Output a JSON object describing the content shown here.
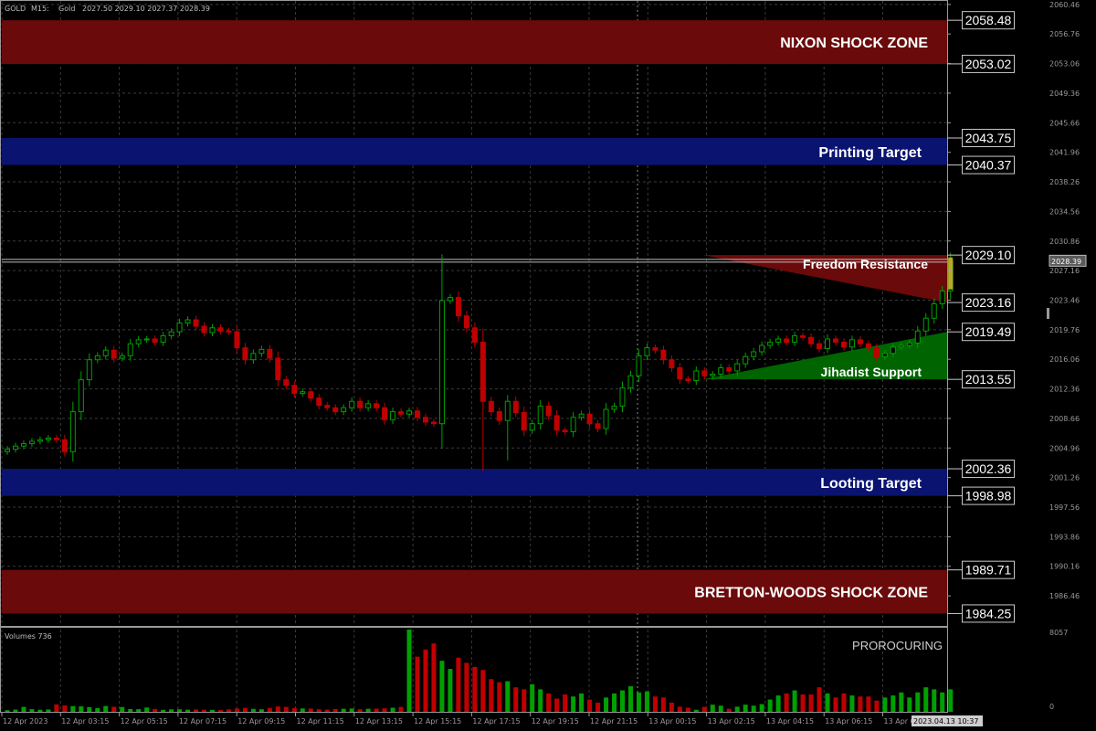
{
  "header": {
    "symbol": "GOLD",
    "timeframe": "M15:",
    "instrument": "Gold",
    "ohlc": "2027.50 2029.10 2027.37 2028.39"
  },
  "volume_panel": {
    "title": "Volumes 736",
    "axis_max_label": "8057",
    "axis_min_label": "0"
  },
  "watermark": "PROROCURING",
  "current_price_label": "2028.39",
  "cursor_time_label": "2023.04.13 10:37",
  "colors": {
    "background": "#000000",
    "grid": "#3a3a3a",
    "bull": "#00a000",
    "bear": "#c00000",
    "shock_zone": "#6b0a0a",
    "target_zone": "#0a1470",
    "resistance_triangle": "#6b0a0a",
    "support_triangle": "#006400",
    "axis_text": "#9a9a9a",
    "price_box_border": "#c8c8c8"
  },
  "chart_data": {
    "type": "candlestick",
    "price_ylim": [
      1982.7,
      2060.9
    ],
    "price_ticks": [
      "2060.46",
      "2056.76",
      "2053.06",
      "2049.36",
      "2045.66",
      "2041.96",
      "2038.26",
      "2034.56",
      "2030.86",
      "2027.16",
      "2023.46",
      "2019.76",
      "2016.06",
      "2012.36",
      "2008.66",
      "2004.96",
      "2001.26",
      "1997.56",
      "1993.86",
      "1990.16",
      "1986.46"
    ],
    "time_labels": [
      "12 Apr 2023",
      "12 Apr 03:15",
      "12 Apr 05:15",
      "12 Apr 07:15",
      "12 Apr 09:15",
      "12 Apr 11:15",
      "12 Apr 13:15",
      "12 Apr 15:15",
      "12 Apr 17:15",
      "12 Apr 19:15",
      "12 Apr 21:15",
      "13 Apr 00:15",
      "13 Apr 02:15",
      "13 Apr 04:15",
      "13 Apr 06:15",
      "13 Apr 08:15"
    ],
    "grid": true,
    "zones": [
      {
        "name": "NIXON SHOCK ZONE",
        "type": "shock",
        "top": 2058.48,
        "bottom": 2053.02
      },
      {
        "name": "Printing Target",
        "type": "target",
        "top": 2043.75,
        "bottom": 2040.37
      },
      {
        "name": "Looting Target",
        "type": "target",
        "top": 2002.36,
        "bottom": 1998.98
      },
      {
        "name": "BRETTON-WOODS SHOCK ZONE",
        "type": "shock",
        "top": 1989.71,
        "bottom": 1984.25
      }
    ],
    "triangles": [
      {
        "name": "Freedom Resistance",
        "type": "resistance",
        "start_index": 85,
        "start_price": 2029.1,
        "top": 2029.1,
        "bottom": 2023.16
      },
      {
        "name": "Jihadist Support",
        "type": "support",
        "start_index": 85,
        "start_price": 2013.55,
        "top": 2019.49,
        "bottom": 2013.55
      }
    ],
    "price_labels": [
      "2058.48",
      "2053.02",
      "2043.75",
      "2040.37",
      "2029.10",
      "2023.16",
      "2019.49",
      "2013.55",
      "2002.36",
      "1998.98",
      "1989.71",
      "1984.25"
    ],
    "closes": [
      2004.8,
      2005.2,
      2005.5,
      2005.8,
      2006.0,
      2006.2,
      2006.0,
      2004.5,
      2009.5,
      2013.5,
      2016.0,
      2016.5,
      2017.2,
      2016.2,
      2016.5,
      2018.0,
      2018.5,
      2018.6,
      2018.2,
      2019.0,
      2019.5,
      2020.6,
      2021.0,
      2020.2,
      2019.4,
      2020.0,
      2019.6,
      2019.5,
      2017.5,
      2016.0,
      2016.8,
      2017.3,
      2016.2,
      2013.5,
      2012.8,
      2011.8,
      2012.0,
      2011.2,
      2010.3,
      2010.0,
      2009.5,
      2010.0,
      2010.8,
      2010.0,
      2010.5,
      2010.0,
      2008.5,
      2009.5,
      2009.2,
      2009.6,
      2008.8,
      2008.2,
      2008.0,
      2023.4,
      2023.8,
      2021.5,
      2020.0,
      2018.2,
      2010.8,
      2009.5,
      2008.4,
      2010.8,
      2009.4,
      2007.2,
      2008.0,
      2010.2,
      2009.0,
      2007.2,
      2007.0,
      2008.8,
      2009.2,
      2008.0,
      2007.4,
      2009.8,
      2010.2,
      2012.5,
      2014.0,
      2016.5,
      2017.5,
      2017.2,
      2016.0,
      2015.0,
      2013.6,
      2013.4,
      2014.6,
      2014.0,
      2014.2,
      2015.0,
      2014.6,
      2015.5,
      2016.4,
      2017.0,
      2017.8,
      2018.2,
      2018.6,
      2018.2,
      2019.0,
      2018.8,
      2018.0,
      2017.4,
      2018.6,
      2018.2,
      2017.6,
      2018.5,
      2018.0,
      2017.5,
      2016.4,
      2016.8,
      2017.6,
      2017.8,
      2018.1,
      2019.6,
      2021.2,
      2023.0,
      2024.6,
      2028.39
    ],
    "volumes": [
      160,
      220,
      480,
      260,
      200,
      230,
      720,
      620,
      560,
      530,
      460,
      360,
      570,
      490,
      470,
      270,
      260,
      420,
      280,
      190,
      240,
      250,
      210,
      230,
      200,
      190,
      170,
      240,
      320,
      380,
      290,
      250,
      370,
      520,
      480,
      360,
      330,
      320,
      250,
      220,
      280,
      300,
      320,
      250,
      300,
      310,
      340,
      400,
      480,
      8057,
      5400,
      6100,
      6700,
      5000,
      4200,
      5300,
      4800,
      4400,
      4100,
      3200,
      2900,
      3000,
      2400,
      2200,
      2700,
      2200,
      1800,
      1300,
      1700,
      1500,
      1800,
      1200,
      900,
      1400,
      1800,
      2100,
      2500,
      1900,
      2000,
      1500,
      1400,
      900,
      500,
      400,
      200,
      480,
      700,
      600,
      300,
      500,
      700,
      600,
      750,
      1200,
      1600,
      1800,
      2100,
      1700,
      1700,
      2400,
      1800,
      1400,
      1800,
      1600,
      1500,
      1500,
      1100,
      1400,
      1600,
      1900,
      1400,
      1900,
      2400,
      2200,
      1900,
      2200
    ]
  }
}
